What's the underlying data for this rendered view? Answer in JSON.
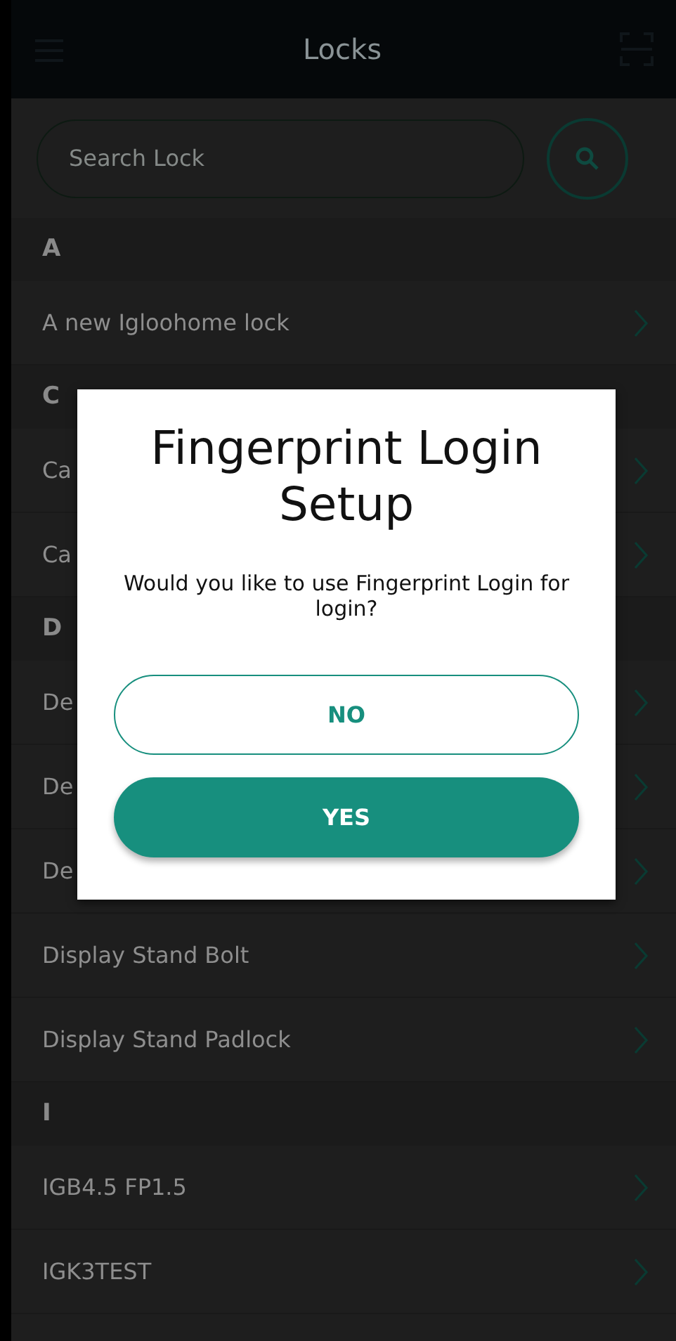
{
  "header": {
    "title": "Locks"
  },
  "search": {
    "placeholder": "Search Lock"
  },
  "sections": [
    {
      "letter": "A",
      "items": [
        "A new Igloohome lock"
      ]
    },
    {
      "letter": "C",
      "items": [
        "Ca",
        "Ca"
      ]
    },
    {
      "letter": "D",
      "items": [
        "De",
        "De",
        "De",
        "Display Stand Bolt",
        "Display Stand Padlock"
      ]
    },
    {
      "letter": "I",
      "items": [
        "IGB4.5 FP1.5",
        "IGK3TEST"
      ]
    }
  ],
  "dialog": {
    "title": "Fingerprint Login Setup",
    "message": "Would you like to use Fingerprint Login for login?",
    "buttons": [
      {
        "label": "NO",
        "kind": "outline"
      },
      {
        "label": "YES",
        "kind": "filled"
      }
    ]
  }
}
